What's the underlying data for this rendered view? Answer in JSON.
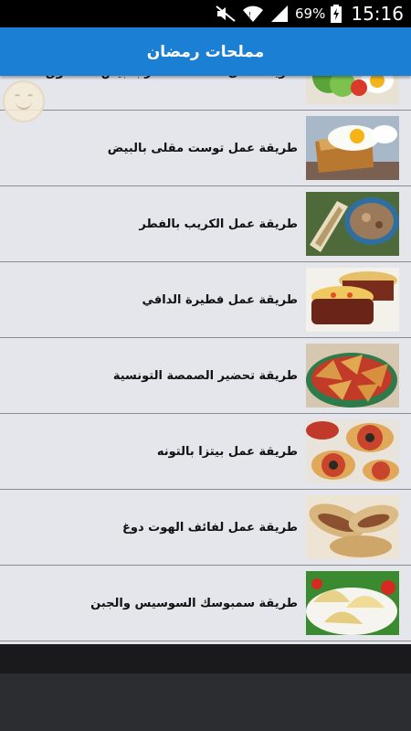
{
  "status_bar": {
    "battery_percent": "69%",
    "time": "15:16",
    "icons": [
      "mute-icon",
      "wifi-icon",
      "signal-icon",
      "battery-charging-icon"
    ]
  },
  "app_bar": {
    "title": "مملحات رمضان"
  },
  "recipes": [
    {
      "label": "طريقة عمل سلطة الخضار بالبيض المسلوق",
      "thumb": "salad-egg"
    },
    {
      "label": "طريقة عمل توست مقلى بالبيض",
      "thumb": "toast-egg"
    },
    {
      "label": "طريقة عمل الكريب بالفطر",
      "thumb": "crepe"
    },
    {
      "label": "طريقة عمل فطيرة الدافي",
      "thumb": "pie"
    },
    {
      "label": "طريقة تحضير الصمصة التونسية",
      "thumb": "samsa"
    },
    {
      "label": "طريقة عمل بيتزا بالتونه",
      "thumb": "pizza"
    },
    {
      "label": "طريقة عمل لفائف الهوت دوغ",
      "thumb": "rolls"
    },
    {
      "label": "طريقة سمبوسك السوسيس والجبن",
      "thumb": "sambousek"
    }
  ],
  "colors": {
    "app_bar": "#1b7fd4",
    "list_bg": "#e4e6eb",
    "divider": "#8a8b8f"
  }
}
